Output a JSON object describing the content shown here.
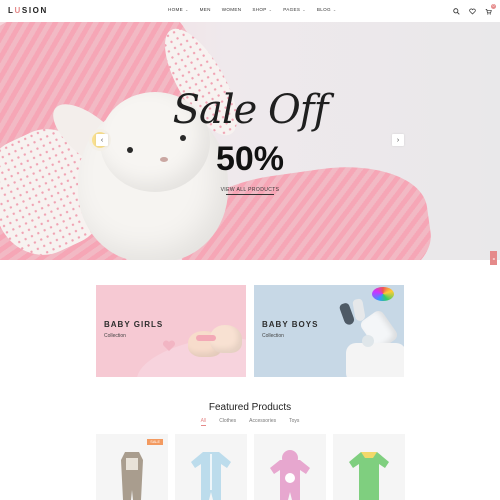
{
  "logo": {
    "prefix": "L",
    "accent": "U",
    "rest": "SION"
  },
  "nav": [
    {
      "label": "HOME",
      "dropdown": true
    },
    {
      "label": "MEN",
      "dropdown": false
    },
    {
      "label": "WOMEN",
      "dropdown": false
    },
    {
      "label": "SHOP",
      "dropdown": true
    },
    {
      "label": "PAGES",
      "dropdown": true
    },
    {
      "label": "BLOG",
      "dropdown": true
    }
  ],
  "header_icons": [
    "search-icon",
    "heart-icon",
    "cart-icon"
  ],
  "cart_count": "0",
  "hero": {
    "script": "Sale Off",
    "big": "50%",
    "link": "VIEW ALL PRODUCTS"
  },
  "banners": [
    {
      "title": "BABY GIRLS",
      "subtitle": "Collection"
    },
    {
      "title": "BABY BOYS",
      "subtitle": "Collection"
    }
  ],
  "featured": {
    "title": "Featured Products",
    "filters": [
      "All",
      "Clothes",
      "Accessories",
      "Toys"
    ],
    "active_filter": "All"
  },
  "products": [
    {
      "badge": "SALE",
      "color": "#a99d8e"
    },
    {
      "badge": "",
      "color": "#bcdcec"
    },
    {
      "badge": "",
      "color": "#e7a7cf"
    },
    {
      "badge": "",
      "color": "#7fcf7f"
    }
  ],
  "colors": {
    "accent": "#e58a8a",
    "sale": "#f39a60"
  }
}
